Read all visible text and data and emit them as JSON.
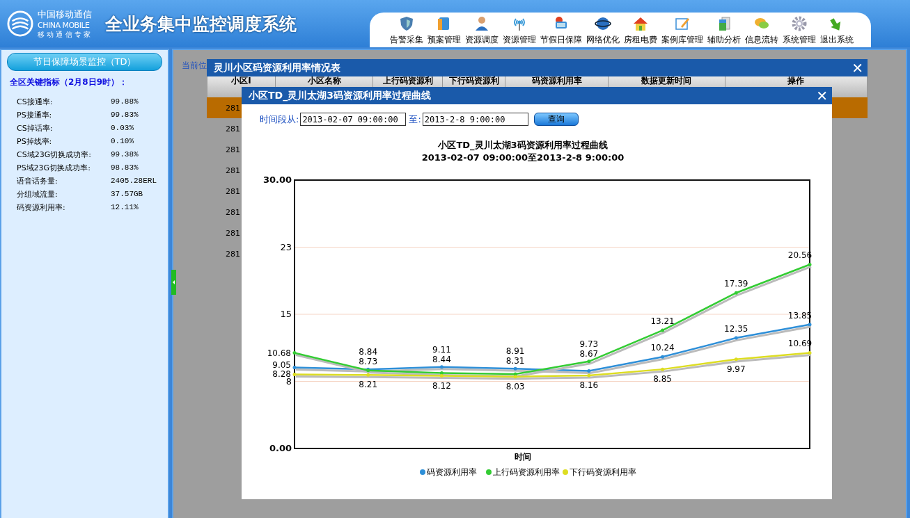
{
  "header": {
    "logo_cn": "中国移动通信",
    "logo_en": "CHINA MOBILE",
    "logo_slogan": "移 动 通 信 专 家",
    "system_title": "全业务集中监控调度系统"
  },
  "nav": [
    {
      "label": "告警采集"
    },
    {
      "label": "预案管理"
    },
    {
      "label": "资源调度"
    },
    {
      "label": "资源管理"
    },
    {
      "label": "节假日保障"
    },
    {
      "label": "网络优化"
    },
    {
      "label": "房租电费"
    },
    {
      "label": "案例库管理"
    },
    {
      "label": "辅助分析"
    },
    {
      "label": "信息流转"
    },
    {
      "label": "系统管理"
    },
    {
      "label": "退出系统"
    }
  ],
  "sidebar": {
    "title": "节日保障场景监控（TD）",
    "subtitle": "全区关键指标（2月8日9时）：",
    "metrics": [
      {
        "label": "CS接通率:",
        "value": "99.88%"
      },
      {
        "label": "PS接通率:",
        "value": "99.83%"
      },
      {
        "label": "CS掉话率:",
        "value": "0.03%"
      },
      {
        "label": "PS掉线率:",
        "value": "0.10%"
      },
      {
        "label": "CS域23G切换成功率:",
        "value": "99.38%"
      },
      {
        "label": "PS域23G切换成功率:",
        "value": "98.83%"
      },
      {
        "label": "语音话务量:",
        "value": "2405.28ERL"
      },
      {
        "label": "分组域流量:",
        "value": "37.57GB"
      },
      {
        "label": "码资源利用率:",
        "value": "12.11%"
      }
    ]
  },
  "background": {
    "breadcrumb": "当前位",
    "rows": [
      {
        "cell": "281",
        "selected": true
      },
      {
        "cell": "281",
        "selected": false
      },
      {
        "cell": "281",
        "selected": false
      },
      {
        "cell": "281",
        "selected": false
      },
      {
        "cell": "281",
        "selected": false
      },
      {
        "cell": "281",
        "selected": false
      },
      {
        "cell": "281",
        "selected": false
      },
      {
        "cell": "281",
        "selected": false
      }
    ]
  },
  "outer_dialog": {
    "title": "灵川小区码资源利用率情况表",
    "close": "✕",
    "columns": [
      "小区I",
      "小区名称",
      "上行码资源利",
      "下行码资源利",
      "码资源利用率",
      "数据更新时间",
      "操作"
    ]
  },
  "inner_dialog": {
    "title": "小区TD_灵川太湖3码资源利用率过程曲线",
    "close": "✕",
    "from_label": "时间段从:",
    "from_value": "2013-02-07 09:00:00",
    "to_label": "至:",
    "to_value": "2013-2-8 9:00:00",
    "query_button": "查询",
    "chart_data": {
      "type": "line",
      "title": "小区TD_灵川太湖3码资源利用率过程曲线\n2013-02-07 09:00:00至2013-2-8 9:00:00",
      "xlabel": "时间",
      "grid": true,
      "legend": "bottom",
      "ylim": [
        0,
        30
      ],
      "yticks": [
        {
          "value": 0,
          "label": "0.00"
        },
        {
          "value": 7.5,
          "label": "8"
        },
        {
          "value": 15,
          "label": "15"
        },
        {
          "value": 22.5,
          "label": "23"
        },
        {
          "value": 30,
          "label": "30.00"
        }
      ],
      "data_labels": true,
      "series": [
        {
          "name": "码资源利用率",
          "color": "#2e8fd8",
          "values": [
            9.05,
            8.84,
            9.11,
            8.91,
            8.67,
            10.24,
            12.35,
            13.85
          ]
        },
        {
          "name": "上行码资源利用率",
          "color": "#33cc33",
          "values": [
            10.68,
            8.73,
            8.44,
            8.31,
            9.73,
            13.21,
            17.39,
            20.56
          ]
        },
        {
          "name": "下行码资源利用率",
          "color": "#dddd22",
          "values": [
            8.28,
            8.21,
            8.12,
            8.03,
            8.16,
            8.85,
            9.97,
            10.69
          ]
        }
      ]
    }
  }
}
